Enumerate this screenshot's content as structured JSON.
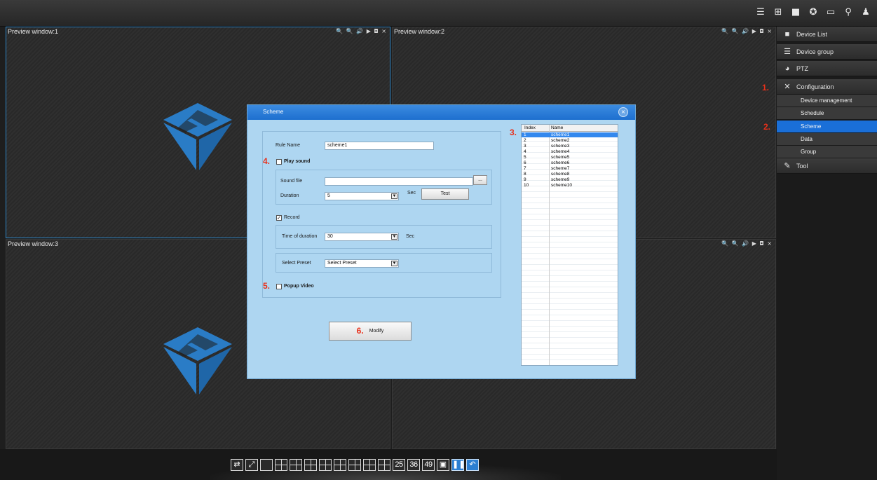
{
  "top_icons": [
    "list-icon",
    "tree-icon",
    "camera-icon",
    "settings-icon",
    "monitor-icon",
    "pin-icon",
    "user-icon"
  ],
  "preview": {
    "windows": [
      {
        "title": "Preview window:1",
        "controls": "🔍 🔍 🔊 ▶ ◘ ×"
      },
      {
        "title": "Preview window:2",
        "controls": "🔍 🔍 🔊 ▶ ◘ ×"
      },
      {
        "title": "Preview window:3",
        "controls": ""
      },
      {
        "title": "",
        "controls": "🔍 🔍 🔊 ▶ ◘ ×"
      }
    ]
  },
  "sidebar": {
    "items": [
      {
        "label": "Device List",
        "icon": "camera-icon"
      },
      {
        "label": "Device group",
        "icon": "list-icon"
      },
      {
        "label": "PTZ",
        "icon": "ptz-icon"
      },
      {
        "label": "Configuration",
        "icon": "tools-icon"
      },
      {
        "label": "Tool",
        "icon": "wrench-icon"
      }
    ],
    "sub_items": [
      {
        "label": "Device management",
        "selected": false
      },
      {
        "label": "Schedule",
        "selected": false
      },
      {
        "label": "Scheme",
        "selected": true
      },
      {
        "label": "Data",
        "selected": false
      },
      {
        "label": "Group",
        "selected": false
      }
    ]
  },
  "markers": {
    "m1": "1.",
    "m2": "2.",
    "m3": "3.",
    "m4": "4.",
    "m5": "5.",
    "m6": "6."
  },
  "dialog": {
    "title": "Scheme",
    "rule_name_label": "Rule Name",
    "rule_name_value": "scheme1",
    "play_sound_label": "Play sound",
    "play_sound_checked": false,
    "sound_file_label": "Sound file",
    "sound_file_value": "",
    "browse_label": "...",
    "duration_label": "Duration",
    "duration_value": "5",
    "duration_unit": "Sec",
    "test_label": "Test",
    "record_label": "Record",
    "record_checked": true,
    "time_of_duration_label": "Time of duration",
    "time_of_duration_value": "30",
    "time_unit": "Sec",
    "select_preset_label": "Select Preset",
    "select_preset_value": "Select Preset",
    "popup_video_label": "Popup Video",
    "popup_video_checked": false,
    "modify_label": "Modify",
    "list": {
      "headers": [
        "Index",
        "Name"
      ],
      "rows": [
        [
          "1",
          "scheme1"
        ],
        [
          "2",
          "scheme2"
        ],
        [
          "3",
          "scheme3"
        ],
        [
          "4",
          "scheme4"
        ],
        [
          "5",
          "scheme5"
        ],
        [
          "6",
          "scheme6"
        ],
        [
          "7",
          "scheme7"
        ],
        [
          "8",
          "scheme8"
        ],
        [
          "9",
          "scheme9"
        ],
        [
          "10",
          "scheme10"
        ]
      ],
      "selected_index": 0
    }
  },
  "layout_buttons": [
    {
      "label": "⇄",
      "icon": "switch-icon"
    },
    {
      "label": "⤢",
      "icon": "fullscreen-icon"
    },
    {
      "label": "",
      "icon": "layout-1-icon"
    },
    {
      "label": "",
      "icon": "layout-4-icon"
    },
    {
      "label": "",
      "icon": "layout-6-icon"
    },
    {
      "label": "",
      "icon": "layout-8-icon"
    },
    {
      "label": "",
      "icon": "layout-9-icon"
    },
    {
      "label": "",
      "icon": "layout-10-icon"
    },
    {
      "label": "",
      "icon": "layout-13-icon"
    },
    {
      "label": "",
      "icon": "layout-16-icon"
    },
    {
      "label": "",
      "icon": "layout-20-icon"
    },
    {
      "label": "25",
      "icon": ""
    },
    {
      "label": "36",
      "icon": ""
    },
    {
      "label": "49",
      "icon": ""
    },
    {
      "label": "▣",
      "icon": "record-icon"
    },
    {
      "label": "❚❚",
      "icon": "pause-icon"
    },
    {
      "label": "↶",
      "icon": "back-icon"
    }
  ],
  "colors": {
    "accent": "#1a6fd8",
    "dialog_bg": "#aed6f1",
    "marker": "#e8301a",
    "logo": "#2a7cc6"
  }
}
